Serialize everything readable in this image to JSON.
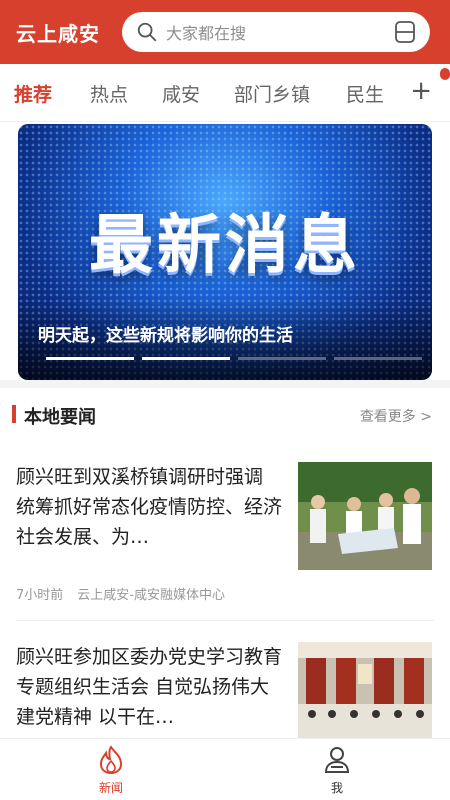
{
  "header": {
    "logo": "云上咸安",
    "search_placeholder": "大家都在搜"
  },
  "tabs": [
    {
      "label": "推荐",
      "active": true
    },
    {
      "label": "热点",
      "active": false
    },
    {
      "label": "咸安",
      "active": false
    },
    {
      "label": "部门乡镇",
      "active": false
    },
    {
      "label": "民生",
      "active": false
    }
  ],
  "tab_add": "+",
  "banner": {
    "headline": "最新消息",
    "caption": "明天起，这些新规将影响你的生活",
    "slide_count": 4,
    "active_slide": 1
  },
  "section": {
    "title": "本地要闻",
    "more": "查看更多 >"
  },
  "news": [
    {
      "title": "顾兴旺到双溪桥镇调研时强调 统筹抓好常态化疫情防控、经济社会发展、为…",
      "time": "7小时前",
      "source": "云上咸安-咸安融媒体中心"
    },
    {
      "title": "顾兴旺参加区委办党史学习教育专题组织生活会 自觉弘扬伟大建党精神 以干在…",
      "time": "",
      "source": ""
    }
  ],
  "nav": {
    "news": "新闻",
    "me": "我"
  },
  "colors": {
    "brand": "#d8402e"
  }
}
